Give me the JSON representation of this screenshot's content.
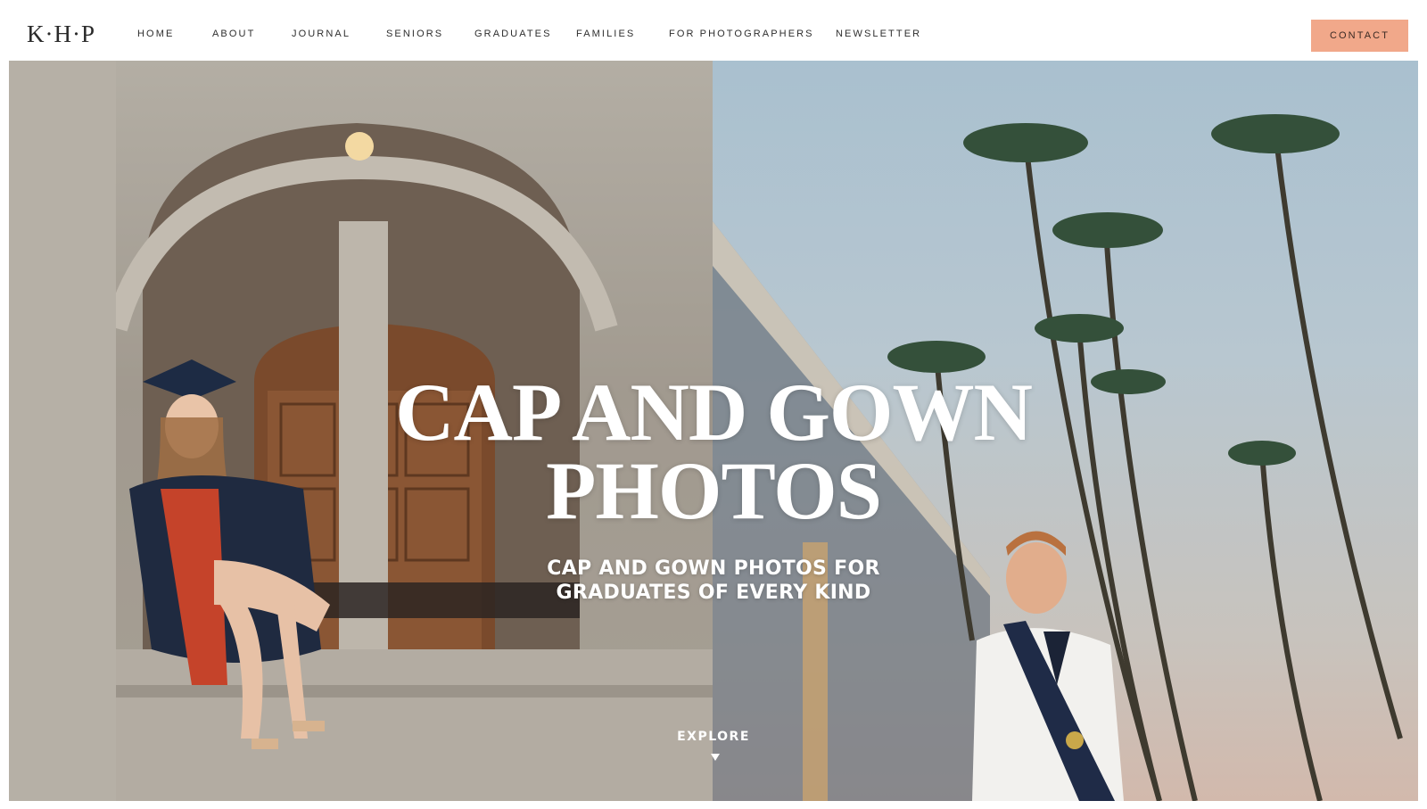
{
  "logo": {
    "text": "K·H·P"
  },
  "nav": {
    "items": [
      {
        "label": "HOME"
      },
      {
        "label": "ABOUT"
      },
      {
        "label": "JOURNAL"
      },
      {
        "label": "SENIORS"
      },
      {
        "label": "GRADUATES"
      },
      {
        "label": "FAMILIES"
      },
      {
        "label": "FOR PHOTOGRAPHERS"
      },
      {
        "label": "NEWSLETTER"
      }
    ],
    "contact_label": "CONTACT"
  },
  "hero": {
    "title_line1": "CAP AND GOWN",
    "title_line2": "PHOTOS",
    "subtitle_line1": "CAP AND GOWN PHOTOS FOR",
    "subtitle_line2": "GRADUATES OF EVERY KIND",
    "explore_label": "EXPLORE"
  },
  "colors": {
    "accent": "#f1a88a",
    "text": "#2e2e2e",
    "hero_text": "#ffffff"
  }
}
